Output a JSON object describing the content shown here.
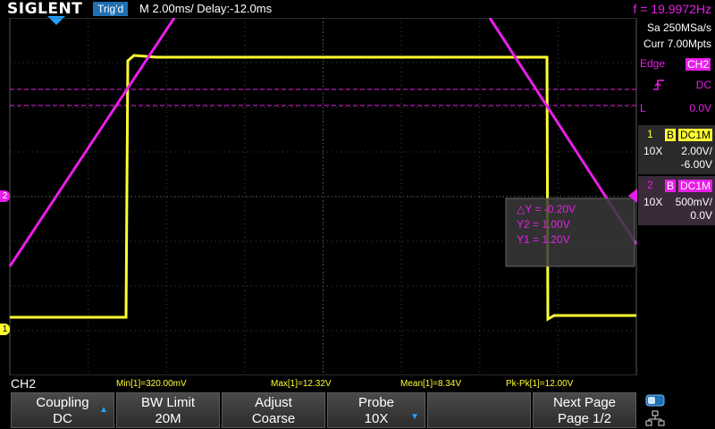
{
  "header": {
    "logo": "SIGLENT",
    "trigger_status": "Trig'd",
    "timebase": "M 2.00ms/ Delay:-12.0ms",
    "frequency": "f = 19.9972Hz"
  },
  "acquisition": {
    "sample_rate": "Sa 250MSa/s",
    "memory": "Curr 7.00Mpts"
  },
  "trigger": {
    "type": "Edge",
    "source": "CH2",
    "slope_icon": "rising-edge-icon",
    "coupling": "DC",
    "level_label": "L",
    "level": "0.0V"
  },
  "channels": [
    {
      "num": "1",
      "bw": "B",
      "coupling": "DC1M",
      "probe": "10X",
      "scale": "2.00V/",
      "offset": "-6.00V",
      "color": "#ffff33"
    },
    {
      "num": "2",
      "bw": "B",
      "coupling": "DC1M",
      "probe": "10X",
      "scale": "500mV/",
      "offset": "0.0V",
      "color": "#e81ee8"
    }
  ],
  "markers": {
    "ch1": "1",
    "ch2": "2"
  },
  "cursor_readout": {
    "delta_y": "△Y = -0.20V",
    "y2": "Y2 = 1.00V",
    "y1": "Y1 = 1.20V"
  },
  "measurements": {
    "source": "CH2",
    "min": "Min[1]=320.00mV",
    "max": "Max[1]=12.32V",
    "mean": "Mean[1]=8.34V",
    "pkpk": "Pk-Pk[1]=12.00V"
  },
  "softkeys": [
    {
      "line1": "Coupling",
      "line2": "DC"
    },
    {
      "line1": "BW Limit",
      "line2": "20M"
    },
    {
      "line1": "Adjust",
      "line2": "Coarse"
    },
    {
      "line1": "Probe",
      "line2": "10X"
    },
    {
      "line1": "",
      "line2": ""
    },
    {
      "line1": "Next Page",
      "line2": "Page 1/2"
    }
  ],
  "colors": {
    "ch1": "#ffff33",
    "ch2": "#e81ee8",
    "accent": "#1f6fb2"
  }
}
